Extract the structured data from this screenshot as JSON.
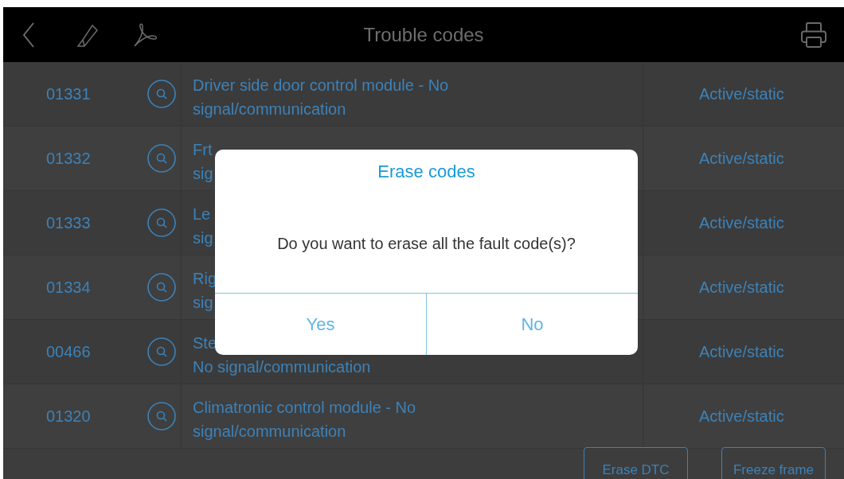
{
  "header": {
    "title": "Trouble codes"
  },
  "rows": [
    {
      "code": "01331",
      "description": "Driver side door control module - No\nsignal/communication",
      "status": "Active/static"
    },
    {
      "code": "01332",
      "description": "Frt\nsig",
      "status": "Active/static"
    },
    {
      "code": "01333",
      "description": "Le\nsig",
      "status": "Active/static"
    },
    {
      "code": "01334",
      "description": "Rig\nsig",
      "status": "Active/static"
    },
    {
      "code": "00466",
      "description": "Ste\nNo signal/communication",
      "status": "Active/static"
    },
    {
      "code": "01320",
      "description": "Climatronic control module - No\nsignal/communication",
      "status": "Active/static"
    }
  ],
  "footer_buttons": [
    "Erase DTC",
    "Freeze frame"
  ],
  "dialog": {
    "title": "Erase codes",
    "message": "Do you want to erase all the fault code(s)?",
    "buttons": [
      "Yes",
      "No"
    ]
  }
}
